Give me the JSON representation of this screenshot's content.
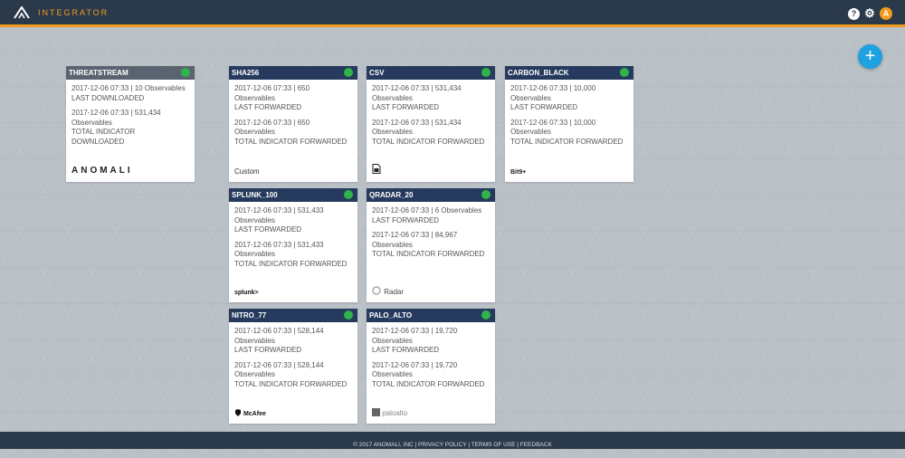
{
  "app": {
    "brand": "INTEGRATOR"
  },
  "topbar": {
    "help_glyph": "?",
    "settings_glyph": "⚙",
    "user_initial": "A"
  },
  "fab": {
    "label": "+"
  },
  "cards": [
    {
      "title": "THREATSTREAM",
      "stats": [
        "2017-12-06 07:33 | 10 Observables",
        "LAST DOWNLOADED",
        "2017-12-06 07:33 | 531,434 Observables",
        "TOTAL INDICATOR DOWNLOADED"
      ],
      "vendor": "ANOMALI"
    },
    {
      "title": "SHA256",
      "stats": [
        "2017-12-06 07:33 | 650 Observables",
        "LAST FORWARDED",
        "2017-12-06 07:33 | 650 Observables",
        "TOTAL INDICATOR FORWARDED"
      ],
      "vendor": "Custom"
    },
    {
      "title": "CSV",
      "stats": [
        "2017-12-06 07:33 | 531,434 Observables",
        "LAST FORWARDED",
        "2017-12-06 07:33 | 531,434 Observables",
        "TOTAL INDICATOR FORWARDED"
      ],
      "vendor": ""
    },
    {
      "title": "CARBON_BLACK",
      "stats": [
        "2017-12-06 07:33 | 10,000 Observables",
        "LAST FORWARDED",
        "2017-12-06 07:33 | 10,000 Observables",
        "TOTAL INDICATOR FORWARDED"
      ],
      "vendor": "Bit9+"
    },
    {
      "title": "SPLUNK_100",
      "stats": [
        "2017-12-06 07:33 | 531,433 Observables",
        "LAST FORWARDED",
        "2017-12-06 07:33 | 531,433 Observables",
        "TOTAL INDICATOR FORWARDED"
      ],
      "vendor": "splunk>"
    },
    {
      "title": "QRADAR_20",
      "stats": [
        "2017-12-06 07:33 | 6 Observables",
        "LAST FORWARDED",
        "2017-12-06 07:33 | 84,967 Observables",
        "TOTAL INDICATOR FORWARDED"
      ],
      "vendor": "Radar"
    },
    {
      "title": "NITRO_77",
      "stats": [
        "2017-12-06 07:33 | 528,144 Observables",
        "LAST FORWARDED",
        "2017-12-06 07:33 | 528,144 Observables",
        "TOTAL INDICATOR FORWARDED"
      ],
      "vendor": "McAfee"
    },
    {
      "title": "PALO_ALTO",
      "stats": [
        "2017-12-06 07:33 | 19,720 Observables",
        "LAST FORWARDED",
        "2017-12-06 07:33 | 19,720 Observables",
        "TOTAL INDICATOR FORWARDED"
      ],
      "vendor": "paloalto"
    }
  ],
  "footer": {
    "text": "© 2017 ANOMALI, INC | PRIVACY POLICY | TERMS OF USE | FEEDBACK"
  },
  "colors": {
    "header_bar": "#2b3a4a",
    "accent": "#f39a1e",
    "card_header": "#263a5e",
    "status_ok": "#2fb34a",
    "fab": "#1da1e0"
  }
}
